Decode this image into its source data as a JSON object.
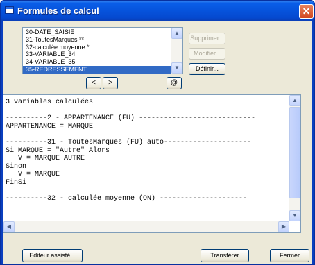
{
  "window": {
    "title": "Formules de calcul",
    "close_glyph": "✕"
  },
  "list": {
    "items": [
      {
        "label": "30-DATE_SAISIE",
        "selected": false
      },
      {
        "label": "31-ToutesMarques **",
        "selected": false
      },
      {
        "label": "32-calculée moyenne *",
        "selected": false
      },
      {
        "label": "33-VARIABLE_34",
        "selected": false
      },
      {
        "label": "34-VARIABLE_35",
        "selected": false
      },
      {
        "label": "35-REDRESSEMENT",
        "selected": true
      }
    ]
  },
  "side_buttons": {
    "supprimer": "Supprimer...",
    "modifier": "Modifier...",
    "definir": "Définir..."
  },
  "nav": {
    "prev": "<",
    "next": ">",
    "at": "@"
  },
  "code": {
    "lines": [
      "3 variables calculées",
      "",
      "----------2 - APPARTENANCE (FU) ----------------------------",
      "APPARTENANCE = MARQUE",
      "",
      "----------31 - ToutesMarques (FU) auto---------------------",
      "Si MARQUE = \"Autre\" Alors",
      "   V = MARQUE_AUTRE",
      "Sinon",
      "   V = MARQUE",
      "FinSi",
      "",
      "----------32 - calculée moyenne (ON) ---------------------"
    ]
  },
  "bottom_buttons": {
    "editeur": "Editeur assisté...",
    "transferer": "Transférer",
    "fermer": "Fermer"
  },
  "icons": {
    "scroll_up": "up-arrow",
    "scroll_down": "down-arrow",
    "scroll_left": "left-arrow",
    "scroll_right": "right-arrow"
  },
  "colors": {
    "title_bar": "#0653dc",
    "selection": "#316ac5",
    "dialog_bg": "#ece9d8",
    "close_button": "#d2461f"
  }
}
